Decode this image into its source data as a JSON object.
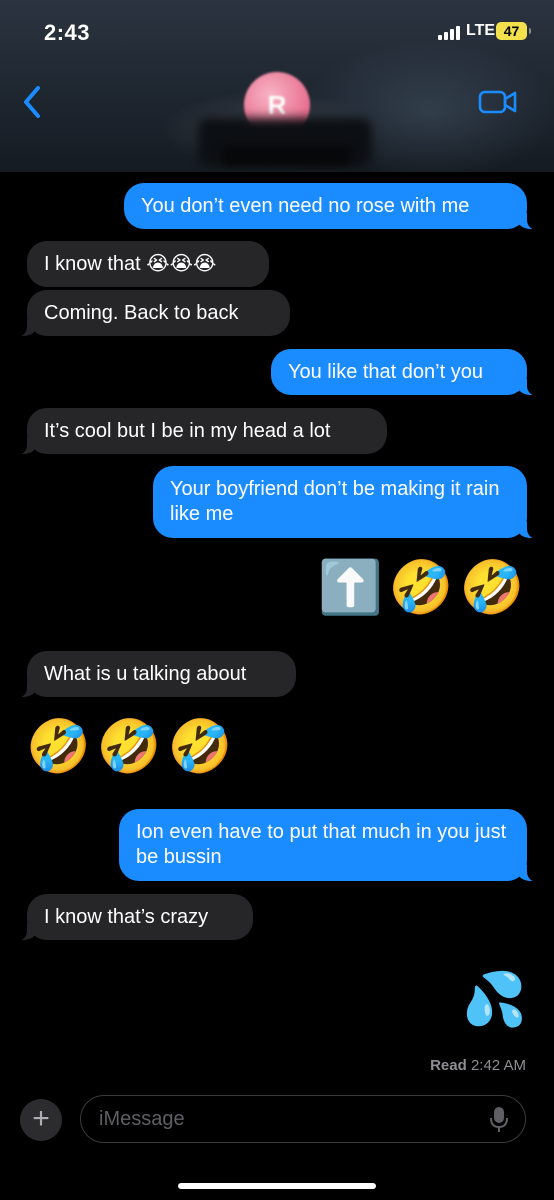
{
  "status": {
    "time": "2:43",
    "network": "LTE",
    "battery": "47"
  },
  "header": {
    "contact_initial": "R",
    "back_icon": "chevron-left-icon",
    "video_icon": "video-camera-icon",
    "accent": "#1a8cff"
  },
  "messages": [
    {
      "side": "sent",
      "text": "You don’t even need no rose with me"
    },
    {
      "side": "received",
      "text": "I know that 😭😭😭"
    },
    {
      "side": "received",
      "text": "Coming. Back to back"
    },
    {
      "side": "sent",
      "text": "You like that don’t you"
    },
    {
      "side": "received",
      "text": "It’s cool but I be in my head a lot"
    },
    {
      "side": "sent",
      "text": "Your boyfriend don’t be making it rain like me"
    },
    {
      "side": "sent",
      "text": "⬆️🤣🤣"
    },
    {
      "side": "received",
      "text": "What is u talking about"
    },
    {
      "side": "received",
      "text": "🤣🤣🤣"
    },
    {
      "side": "sent",
      "text": "Ion even have to put that much in you just be bussin"
    },
    {
      "side": "received",
      "text": "I know that’s crazy"
    },
    {
      "side": "sent",
      "text": "💦"
    }
  ],
  "receipt": {
    "label": "Read",
    "time": "2:42 AM"
  },
  "composer": {
    "placeholder": "iMessage",
    "add_icon": "plus-icon",
    "mic_icon": "microphone-icon"
  }
}
